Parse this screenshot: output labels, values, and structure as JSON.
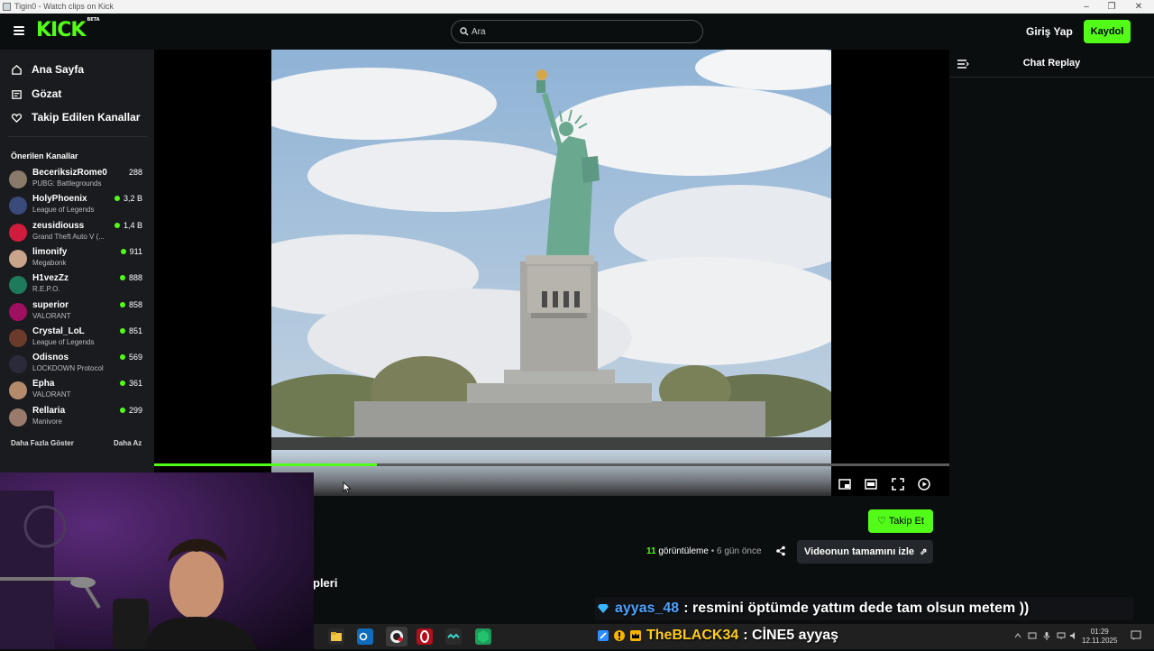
{
  "window": {
    "title": "Tigin0 - Watch clips on Kick",
    "min": "–",
    "max": "❐",
    "close": "✕"
  },
  "header": {
    "logo": "KICK",
    "logo_badge": "BETA",
    "search_placeholder": "Ara",
    "login_label": "Giriş Yap",
    "signup_label": "Kaydol",
    "accent_color": "#53fc18"
  },
  "sidebar": {
    "nav": [
      {
        "label": "Ana Sayfa",
        "icon": "home-icon"
      },
      {
        "label": "Gözat",
        "icon": "browse-icon"
      },
      {
        "label": "Takip Edilen Kanallar",
        "icon": "heart-icon"
      }
    ],
    "section_title": "Önerilen Kanallar",
    "channels": [
      {
        "name": "BeceriksizRome0",
        "game": "PUBG: Battlegrounds",
        "viewers": "288",
        "live": false,
        "color": "#8a7a6a"
      },
      {
        "name": "HolyPhoenix",
        "game": "League of Legends",
        "viewers": "3,2 B",
        "live": true,
        "color": "#3a4a7a"
      },
      {
        "name": "zeusidiouss",
        "game": "Grand Theft Auto V (...",
        "viewers": "1,4 B",
        "live": true,
        "color": "#d01c3c"
      },
      {
        "name": "limonify",
        "game": "Megabonk",
        "viewers": "911",
        "live": true,
        "color": "#c9a38a"
      },
      {
        "name": "H1vezZz",
        "game": "R.E.P.O.",
        "viewers": "888",
        "live": true,
        "color": "#1e7a5a"
      },
      {
        "name": "superior",
        "game": "VALORANT",
        "viewers": "858",
        "live": true,
        "color": "#a01060"
      },
      {
        "name": "Crystal_LoL",
        "game": "League of Legends",
        "viewers": "851",
        "live": true,
        "color": "#6a3a2a"
      },
      {
        "name": "Odisnos",
        "game": "LOCKDOWN Protocol",
        "viewers": "569",
        "live": true,
        "color": "#2a2a3a"
      },
      {
        "name": "Epha",
        "game": "VALORANT",
        "viewers": "361",
        "live": true,
        "color": "#b38a6a"
      },
      {
        "name": "Rellaria",
        "game": "Manivore",
        "viewers": "299",
        "live": true,
        "color": "#9a7a6a"
      }
    ],
    "show_more": "Daha Fazla Göster",
    "show_less": "Daha Az"
  },
  "player": {
    "progress": 0.28
  },
  "chat": {
    "title": "Chat Replay"
  },
  "video_info": {
    "follow_label": "Takip Et",
    "views_count": "11",
    "views_label": "görüntüleme",
    "separator": "•",
    "time_ago": "6 gün önce",
    "full_video_label": "Videonun tamamını izle",
    "tab_partial": "pleri"
  },
  "taskbar": {
    "time": "01:29",
    "date": "12.11.2025"
  },
  "overlay_chat": [
    {
      "user": "ayyas_48",
      "user_color": "#4da3ff",
      "message": ": resmini öptümde yattım dede tam olsun metem ))"
    },
    {
      "user": "TheBLACK34",
      "user_color": "#ffcc1a",
      "message": ": CİNE5 ayyaş"
    }
  ]
}
